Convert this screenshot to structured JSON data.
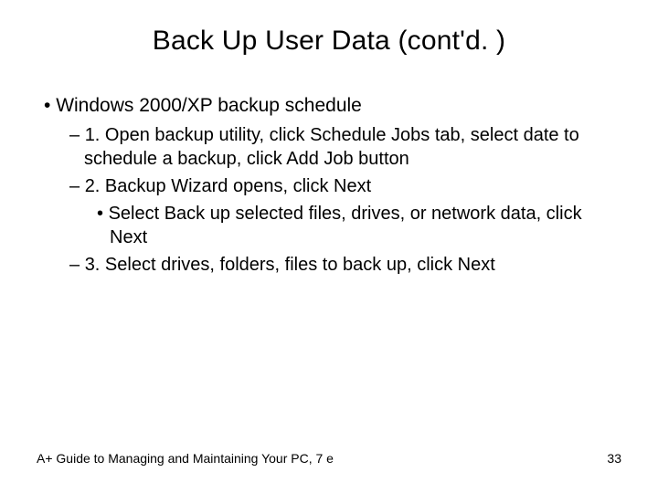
{
  "title": "Back Up User Data (cont'd. )",
  "content": {
    "l1_main": "Windows 2000/XP backup schedule",
    "l2_step1": "1. Open backup utility, click Schedule Jobs tab, select date to schedule a backup, click Add Job button",
    "l2_step2": "2. Backup Wizard opens, click Next",
    "l3_sub": "Select Back up selected files, drives, or network data, click Next",
    "l2_step3": "3. Select drives, folders, files to back up, click Next"
  },
  "footer": {
    "left": "A+ Guide to Managing and Maintaining Your PC, 7 e",
    "right": "33"
  }
}
